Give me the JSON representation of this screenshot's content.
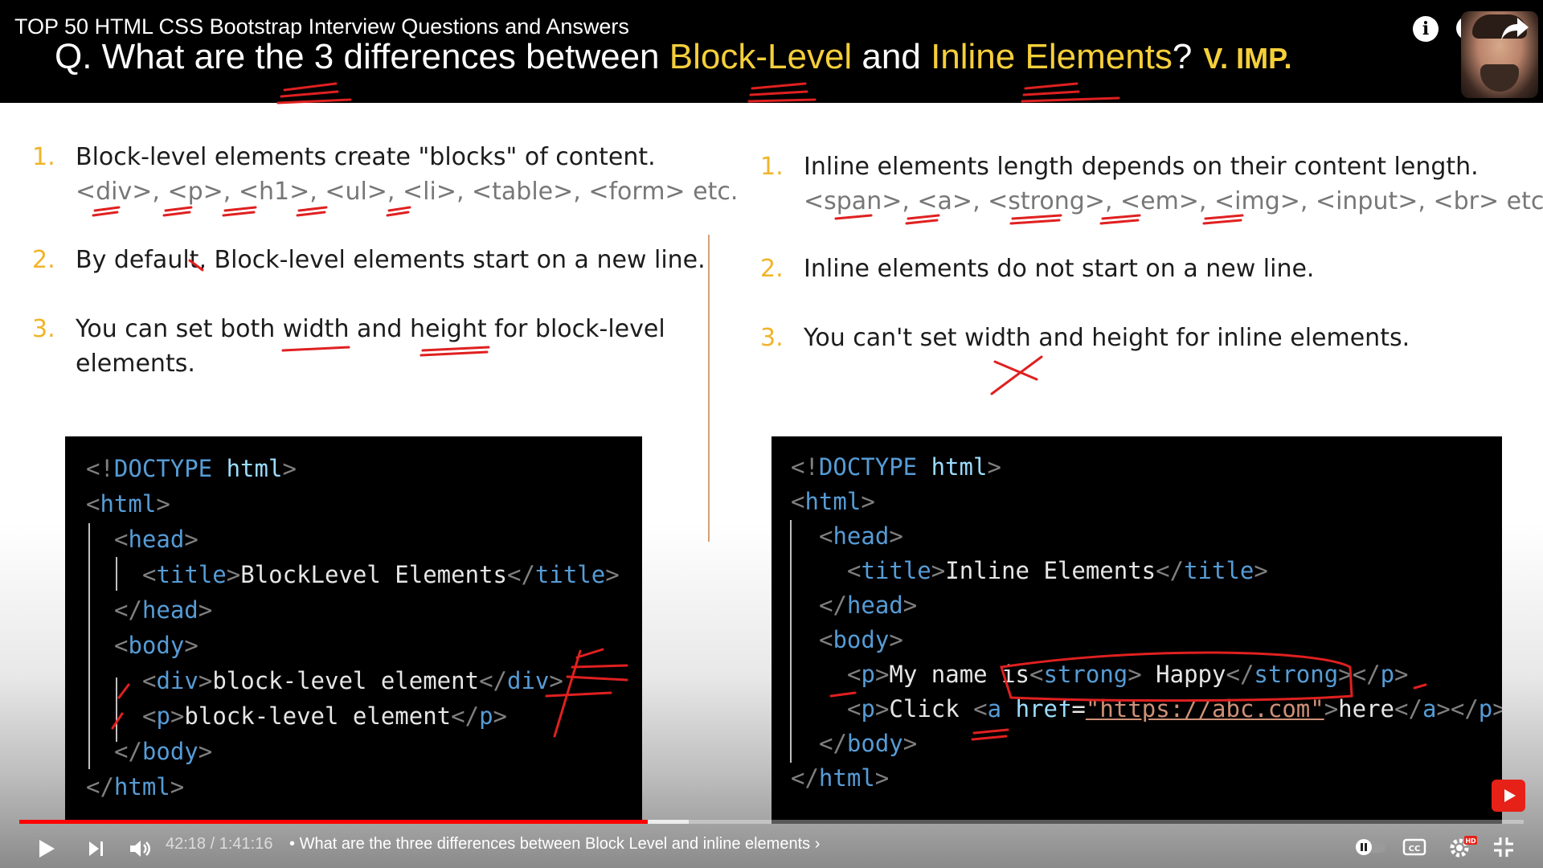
{
  "video": {
    "title": "TOP 50 HTML CSS Bootstrap Interview Questions and Answers"
  },
  "question": {
    "prefix": "Q. What are the 3 differences between ",
    "term1": "Block-Level",
    "middle": " and ",
    "term2": "Inline Elements",
    "suffix": "?",
    "importance": "V. IMP."
  },
  "left_points": [
    {
      "num": "1.",
      "text": "Block-level elements create \"blocks\" of content.",
      "sub": "<div>, <p>, <h1>, <ul>, <li>, <table>, <form> etc."
    },
    {
      "num": "2.",
      "text": "By default, Block-level elements start on a new line."
    },
    {
      "num": "3.",
      "text": "You can set both width and height for block-level",
      "sub": "elements."
    }
  ],
  "right_points": [
    {
      "num": "1.",
      "text": "Inline elements length depends on their content length.",
      "sub": "<span>, <a>, <strong>, <em>, <img>, <input>, <br> etc."
    },
    {
      "num": "2.",
      "text": "Inline elements do not start on a new line."
    },
    {
      "num": "3.",
      "text": "You can't set width and height for inline elements."
    }
  ],
  "left_code": {
    "doctype_open": "<!",
    "doctype_kw": "DOCTYPE",
    "doctype_html": " html",
    "doctype_close": ">",
    "html_tag": "html",
    "head_tag": "head",
    "title_tag": "title",
    "title_text": "BlockLevel Elements",
    "body_tag": "body",
    "div_tag": "div",
    "div_text": "block-level element",
    "p_tag": "p",
    "p_text": "block-level element"
  },
  "right_code": {
    "doctype_open": "<!",
    "doctype_kw": "DOCTYPE",
    "doctype_html": " html",
    "doctype_close": ">",
    "html_tag": "html",
    "head_tag": "head",
    "title_tag": "title",
    "title_text": "Inline Elements",
    "body_tag": "body",
    "p_tag": "p",
    "p1_text": "My name is",
    "strong_tag": "strong",
    "strong_text": " Happy",
    "p2_text": "Click ",
    "a_tag": "a",
    "href_attr": "href",
    "href_value": "\"https://abc.com\"",
    "a_text": "here"
  },
  "player": {
    "time": "42:18 / 1:41:16",
    "separator": "•",
    "chapter": "What are the three differences between Block Level and inline elements",
    "chapter_arrow": "›",
    "progress": 0.418,
    "buffered": 0.445,
    "hd_badge": "HD"
  },
  "colors": {
    "accent_yellow": "#f5cf3b",
    "number_orange": "#f0b429",
    "annotation_red": "#e02020",
    "progress_red": "#ff0000"
  },
  "icons": [
    "info-icon",
    "clock-icon",
    "share-icon",
    "play-icon",
    "next-icon",
    "volume-icon",
    "autoplay-toggle-icon",
    "captions-icon",
    "settings-icon",
    "exit-fullscreen-icon",
    "subscribe-icon"
  ]
}
